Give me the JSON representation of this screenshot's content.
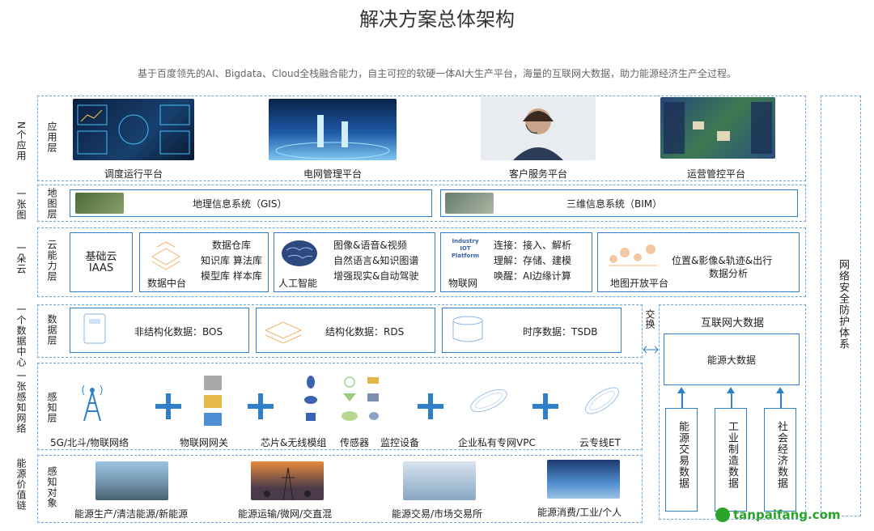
{
  "title": "解决方案总体架构",
  "subtitle": "基于百度领先的AI、Bigdata、Cloud全栈融合能力，自主可控的软硬一体AI大生产平台，海量的互联网大数据，助力能源经济生产全过程。",
  "left_labels": [
    "N个应用",
    "一张图",
    "一朵云",
    "一个数据中心",
    "一张感知网络",
    "能源价值链"
  ],
  "layer_labels": [
    "应用层",
    "地图层",
    "云能力层",
    "数据层",
    "感知层",
    "感知对象"
  ],
  "app_layer": [
    "调度运行平台",
    "电网管理平台",
    "客户服务平台",
    "运营管控平台"
  ],
  "map_layer": [
    "地理信息系统（GIS）",
    "三维信息系统（BIM）"
  ],
  "cloud_layer": {
    "iaas": [
      "基础云",
      "IAAS"
    ],
    "data_center": {
      "lines": [
        "数据仓库",
        "知识库 算法库",
        "模型库 样本库"
      ],
      "caption": "数据中台"
    },
    "ai": {
      "lines": [
        "图像&语音&视频",
        "自然语言&知识图谱",
        "增强现实&自动驾驶"
      ],
      "caption": "人工智能"
    },
    "iot": {
      "logo": "Industry IOT Platform",
      "lines": [
        "连接：接入、解析",
        "理解：存储、建模",
        "唤醒：AI边缘计算"
      ],
      "caption": "物联网"
    },
    "map_platform": {
      "lines": [
        "位置&影像&轨迹&出行",
        "数据分析"
      ],
      "caption": "地图开放平台"
    }
  },
  "data_layer": [
    "非结构化数据：BOS",
    "结构化数据：RDS",
    "时序数据：TSDB"
  ],
  "exchange": "交换",
  "internet_bigdata": {
    "title": "互联网大数据",
    "energy_bigdata": "能源大数据",
    "columns": [
      "能源交易数据",
      "工业制造数据",
      "社会经济数据"
    ]
  },
  "security": "网络安全防护体系",
  "sensing_layer": [
    "5G/北斗/物联网络",
    "物联网网关",
    "芯片&无线模组",
    "传感器",
    "监控设备",
    "企业私有专网VPC",
    "云专线ET"
  ],
  "objects_layer": [
    "能源生产/清洁能源/新能源",
    "能源运输/微网/交直混",
    "能源交易/市场交易所",
    "能源消费/工业/个人"
  ],
  "watermark": "tanpaifang.com",
  "colors": {
    "accent": "#2e7fc8",
    "dashed": "#6aa5db",
    "watermark": "#29a329"
  }
}
